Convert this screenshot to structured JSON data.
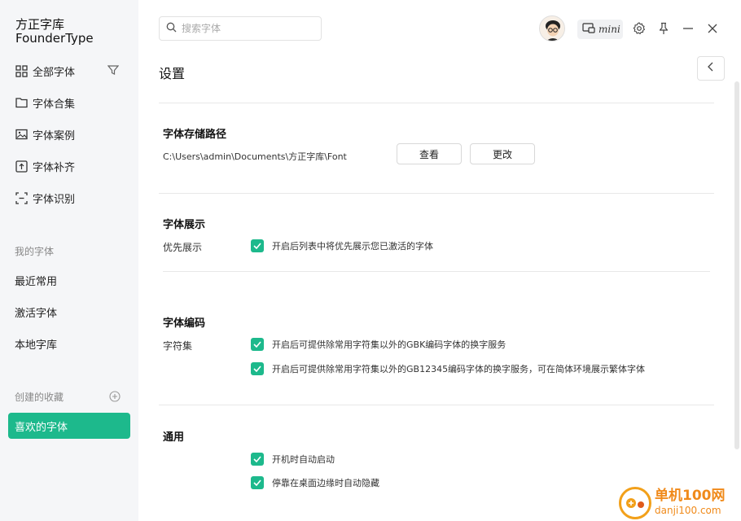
{
  "app": {
    "logo_line1": "方正字库",
    "logo_line2": "FounderType"
  },
  "sidebar": {
    "nav": [
      {
        "label": "全部字体",
        "icon": "grid-icon"
      },
      {
        "label": "字体合集",
        "icon": "folder-icon"
      },
      {
        "label": "字体案例",
        "icon": "image-icon"
      },
      {
        "label": "字体补齐",
        "icon": "font-fill-icon"
      },
      {
        "label": "字体识别",
        "icon": "scan-icon"
      }
    ],
    "my_fonts_label": "我的字体",
    "my_fonts": [
      "最近常用",
      "激活字体",
      "本地字库"
    ],
    "collections_label": "创建的收藏",
    "active_collection": "喜欢的字体"
  },
  "header": {
    "search_placeholder": "搜索字体",
    "mini_label": "mini"
  },
  "settings": {
    "title": "设置",
    "storage": {
      "title": "字体存储路径",
      "path": "C:\\Users\\admin\\Documents\\方正字库\\Font",
      "view_label": "查看",
      "change_label": "更改"
    },
    "display": {
      "title": "字体展示",
      "row_label": "优先展示",
      "option": "开启后列表中将优先展示您已激活的字体"
    },
    "encoding": {
      "title": "字体编码",
      "row_label": "字符集",
      "option1": "开启后可提供除常用字符集以外的GBK编码字体的换字服务",
      "option2": "开启后可提供除常用字符集以外的GB12345编码字体的换字服务，可在简体环境展示繁体字体"
    },
    "general": {
      "title": "通用",
      "option1": "开机时自动启动",
      "option2": "停靠在桌面边缘时自动隐藏"
    }
  },
  "watermark": {
    "line1": "单机100网",
    "line2": "danji100.com"
  },
  "colors": {
    "accent": "#1db98c",
    "sidebar_bg": "#f5f6f8"
  }
}
